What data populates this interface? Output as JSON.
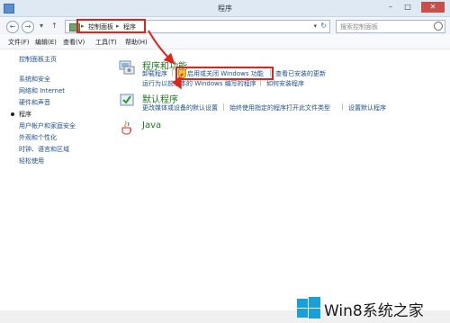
{
  "window": {
    "title": "程序",
    "minimize": "–",
    "maximize": "□",
    "close": "✕"
  },
  "nav": {
    "back": "←",
    "forward": "→",
    "dropdown": "▾",
    "up": "↑",
    "crumbs": [
      "控制面板",
      "程序"
    ],
    "crumb_sep": "▸",
    "address_dropdown": "▾",
    "refresh": "↻",
    "search_placeholder": "搜索控制面板"
  },
  "menu": [
    "文件(F)",
    "编辑(E)",
    "查看(V)",
    "工具(T)",
    "帮助(H)"
  ],
  "sidebar": {
    "items": [
      {
        "label": "控制面板主页"
      },
      {
        "label": "系统和安全"
      },
      {
        "label": "网络和 Internet"
      },
      {
        "label": "硬件和声音"
      },
      {
        "label": "程序",
        "current": true
      },
      {
        "label": "用户帐户和家庭安全"
      },
      {
        "label": "外观和个性化"
      },
      {
        "label": "时钟、语言和区域"
      },
      {
        "label": "轻松使用"
      }
    ]
  },
  "sections": [
    {
      "icon": "programs-icon",
      "heading": "程序和功能",
      "links_row1": [
        "卸载程序",
        "启用或关闭 Windows 功能",
        "查看已安装的更新"
      ],
      "links_row2": [
        "运行为以前版本的 Windows 编写的程序",
        "如何安装程序"
      ]
    },
    {
      "icon": "default-programs-icon",
      "heading": "默认程序",
      "links_row1": [
        "更改媒体或设备的默认设置",
        "始终使用指定的程序打开此文件类型",
        "设置默认程序"
      ]
    },
    {
      "icon": "java-icon",
      "heading": "Java"
    }
  ],
  "watermark": {
    "text": "Win8系统之家"
  },
  "colors": {
    "link": "#1d4f91",
    "heading": "#1e7a1e",
    "highlight": "#e2231a"
  }
}
